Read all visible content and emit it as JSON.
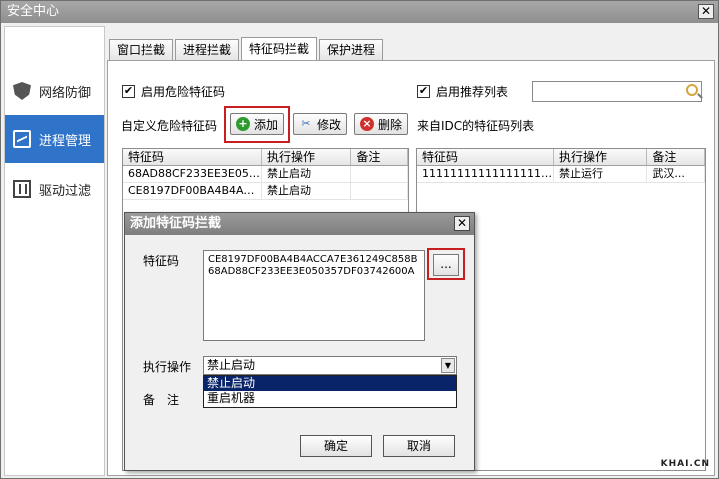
{
  "window": {
    "title": "安全中心",
    "close": "✕"
  },
  "sidebar": {
    "items": [
      {
        "label": "网络防御",
        "icon": "shield-icon"
      },
      {
        "label": "进程管理",
        "icon": "monitor-icon"
      },
      {
        "label": "驱动过滤",
        "icon": "driver-icon"
      }
    ]
  },
  "tabs": [
    {
      "label": "窗口拦截"
    },
    {
      "label": "进程拦截"
    },
    {
      "label": "特征码拦截"
    },
    {
      "label": "保护进程"
    }
  ],
  "main": {
    "enable_danger": "启用危险特征码",
    "enable_recommend": "启用推荐列表",
    "custom_label": "自定义危险特征码",
    "idc_label": "来自IDC的特征码列表",
    "add_btn": "添加",
    "edit_btn": "修改",
    "delete_btn": "删除",
    "search_placeholder": ""
  },
  "left_table": {
    "headers": [
      "特征码",
      "执行操作",
      "备注"
    ],
    "rows": [
      [
        "68AD88CF233EE3E0503...",
        "禁止启动",
        ""
      ],
      [
        "CE8197DF00BA4B4ACC...",
        "禁止启动",
        ""
      ]
    ]
  },
  "right_table": {
    "headers": [
      "特征码",
      "执行操作",
      "备注"
    ],
    "rows": [
      [
        "1111111111111111111...",
        "禁止运行",
        "武汉..."
      ]
    ]
  },
  "dialog": {
    "title": "添加特征码拦截",
    "close": "✕",
    "code_label": "特征码",
    "code_lines": [
      "CE8197DF00BA4B4ACCA7E361249C858B",
      "68AD88CF233EE3E050357DF03742600A"
    ],
    "browse_btn": "...",
    "action_label": "执行操作",
    "action_value": "禁止启动",
    "action_options": [
      "禁止启动",
      "重启机器"
    ],
    "note_label": "备　注",
    "ok_btn": "确定",
    "cancel_btn": "取消"
  },
  "watermark": "KHAI.CN"
}
